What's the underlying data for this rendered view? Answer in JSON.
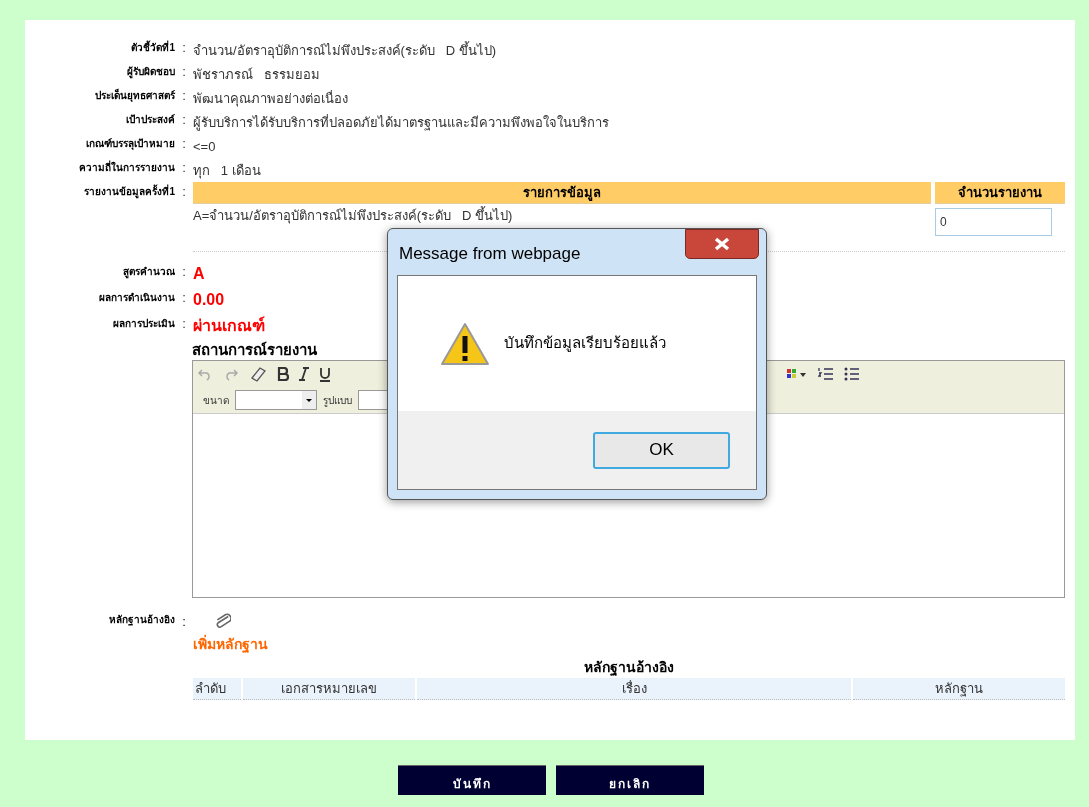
{
  "fields": [
    {
      "label": "ตัวชี้วัดที่1",
      "colon": ":",
      "value": "จำนวน/อัตราอุบัติการณ์ไม่พึงประสงค์(ระดับ   D ขึ้นไป)"
    },
    {
      "label": "ผู้รับผิดชอบ",
      "colon": ":",
      "value": "พัชราภรณ์   ธรรมยอม"
    },
    {
      "label": "ประเด็นยุทธศาสตร์",
      "colon": ":",
      "value": "พัฒนาคุณภาพอย่างต่อเนื่อง"
    },
    {
      "label": "เป้าประสงค์",
      "colon": ":",
      "value": "ผู้รับบริการได้รับบริการที่ปลอดภัยได้มาตรฐานและมีความพึงพอใจในบริการ"
    },
    {
      "label": "เกณฑ์บรรลุเป้าหมาย",
      "colon": ":",
      "value": "<=0"
    },
    {
      "label": "ความถี่ในการรายงาน",
      "colon": ":",
      "value": "ทุก   1 เดือน"
    }
  ],
  "report": {
    "label": "รายงานข้อมูลครั้งที่1",
    "colon": ":",
    "columns": [
      "รายการข้อมูล",
      "จำนวนรายงาน"
    ],
    "rows": [
      {
        "item": "A=จำนวน/อัตราอุบัติการณ์ไม่พึงประสงค์(ระดับ   D ขึ้นไป)",
        "count": "0"
      }
    ]
  },
  "results": [
    {
      "label": "สูตรคำนวณ",
      "colon": ":",
      "value": "A"
    },
    {
      "label": "ผลการดำเนินงาน",
      "colon": ":",
      "value": "0.00"
    },
    {
      "label": "ผลการประเมิน",
      "colon": ":",
      "value": "ผ่านเกณฑ์"
    }
  ],
  "editor": {
    "heading": "สถานการณ์รายงาน",
    "size_label": "ขนาด",
    "style_label": "รูปแบบ"
  },
  "evidence": {
    "label": "หลักฐานอ้างอิง",
    "colon": ":",
    "add_link": "เพิ่มหลักฐาน",
    "table_title": "หลักฐานอ้างอิง",
    "columns": [
      "ลำดับ",
      "เอกสารหมายเลข",
      "เรื่อง",
      "หลักฐาน"
    ]
  },
  "buttons": [
    "บันทึก",
    "ยกเลิก"
  ],
  "dialog": {
    "title": "Message from webpage",
    "message": "บันทึกข้อมูลเรียบร้อยแล้ว",
    "ok": "OK"
  }
}
